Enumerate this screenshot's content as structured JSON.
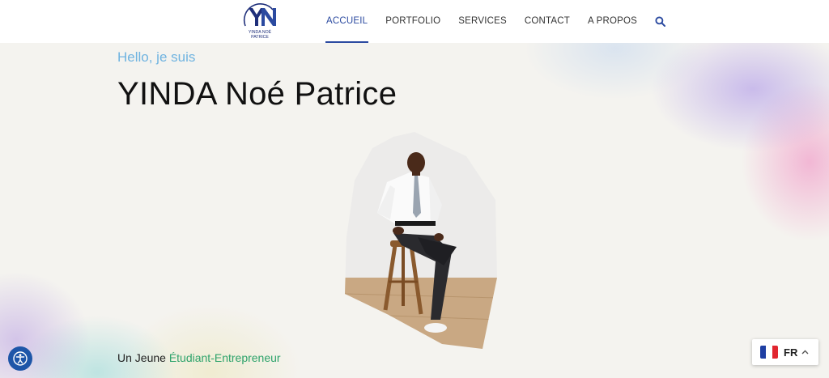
{
  "header": {
    "logo_text_line1": "YINDA NOÉ",
    "logo_text_line2": "PATRICE",
    "nav": [
      {
        "label": "ACCUEIL",
        "active": true
      },
      {
        "label": "PORTFOLIO",
        "active": false
      },
      {
        "label": "SERVICES",
        "active": false
      },
      {
        "label": "CONTACT",
        "active": false
      },
      {
        "label": "A PROPOS",
        "active": false
      }
    ],
    "search_icon": "search-icon"
  },
  "hero": {
    "greeting": "Hello, je suis",
    "name": "YINDA Noé Patrice",
    "tagline_prefix": "Un Jeune ",
    "tagline_highlight": "Étudiant-Entrepreneur"
  },
  "language": {
    "code": "FR",
    "flag": "france-flag-icon"
  },
  "colors": {
    "brand": "#2b4aa0",
    "greeting": "#6fb3e0",
    "highlight": "#2ea36b",
    "accessibility": "#1e56a8"
  }
}
